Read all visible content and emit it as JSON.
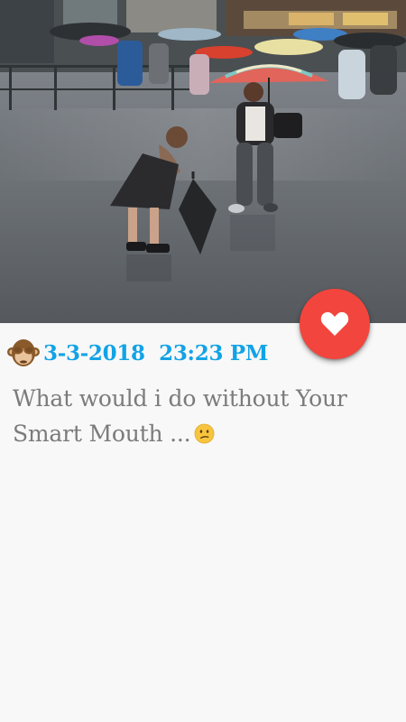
{
  "post": {
    "image_alt": "Girl with umbrella in the rain on a city square",
    "date": "3-3-2018",
    "time": "23:23 PM",
    "author_icon": "see-no-evil-monkey-icon",
    "text": "What would i do without Your Smart Mouth ...",
    "trailing_emoji": "confused-face-icon"
  },
  "actions": {
    "favorite_icon": "heart-icon"
  },
  "colors": {
    "accent_blue": "#12a3e6",
    "fab_red": "#f2453d",
    "body_text": "#7b7b7b",
    "background": "#f8f8f8"
  }
}
